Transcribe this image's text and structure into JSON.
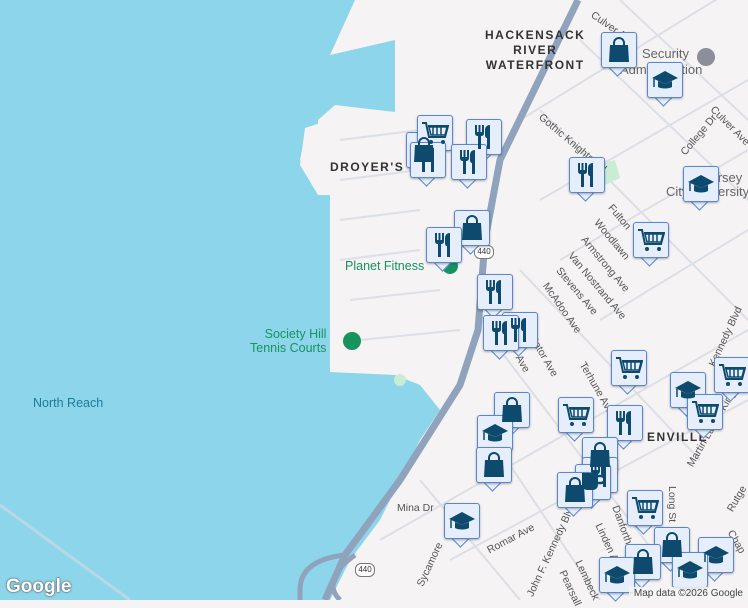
{
  "map": {
    "colors": {
      "water": "#8dd5ea",
      "land": "#f5f3f3",
      "highway": "#8fa3bd",
      "marker_fill": "#e6eefc",
      "marker_border": "#5a86cf",
      "icon": "#0d4a6e",
      "park": "#17935f"
    },
    "areas": {
      "hackensack": "HACKENSACK\nRIVER\nWATERFRONT",
      "droyers": "DROYER'S P",
      "greenville": "ENVILLE"
    },
    "pois": {
      "planet_fitness": "Planet Fitness",
      "society_hill": "Society Hill\nTennis Courts",
      "security": "Security",
      "security2": "Administration",
      "njcu": "Jersey",
      "njcu2": "City University"
    },
    "water": {
      "north_reach": "North Reach"
    },
    "streets": {
      "culver1": "Culver Ave",
      "gothic": "Gothic Knights Rd",
      "college": "College Dr",
      "culver2": "Culver Ave",
      "fulton": "Fulton",
      "woodlawn": "Woodlawn",
      "armstrong": "Armstrong Ave",
      "vannostrand": "Van Nostrand Ave",
      "stevens": "Stevens Ave",
      "mcadoo": "McAdoo Ave",
      "terhune": "Terhune Ave",
      "kennedy": "Kennedy Blvd",
      "mlk": "Martin Luther King",
      "longst": "Long St",
      "rutgers": "Rutge",
      "mina": "Mina Dr",
      "romar": "Romar Ave",
      "sycamore": "Sycamore",
      "jfk": "John F. Kennedy Blvd",
      "pearsall": "Pearsall",
      "lembeck": "Lembeck",
      "linden": "Linden Ave",
      "danforth": "Danforth",
      "cator": "Cator Ave",
      "ave": "Ave",
      "chap": "Chap"
    },
    "route_shield": "440",
    "markers": [
      "shop",
      "edu",
      "shop",
      "cart",
      "food",
      "food",
      "food",
      "food",
      "edu",
      "cart",
      "shop",
      "food",
      "food",
      "food",
      "food",
      "cart",
      "edu",
      "cart",
      "cart",
      "shop",
      "edu",
      "cart",
      "food",
      "shop",
      "shop",
      "food",
      "coffee",
      "shop",
      "edu",
      "cart",
      "shop",
      "shop",
      "edu",
      "edu",
      "edu"
    ],
    "attribution": "Map data ©2026 Google",
    "logo": "Google"
  }
}
